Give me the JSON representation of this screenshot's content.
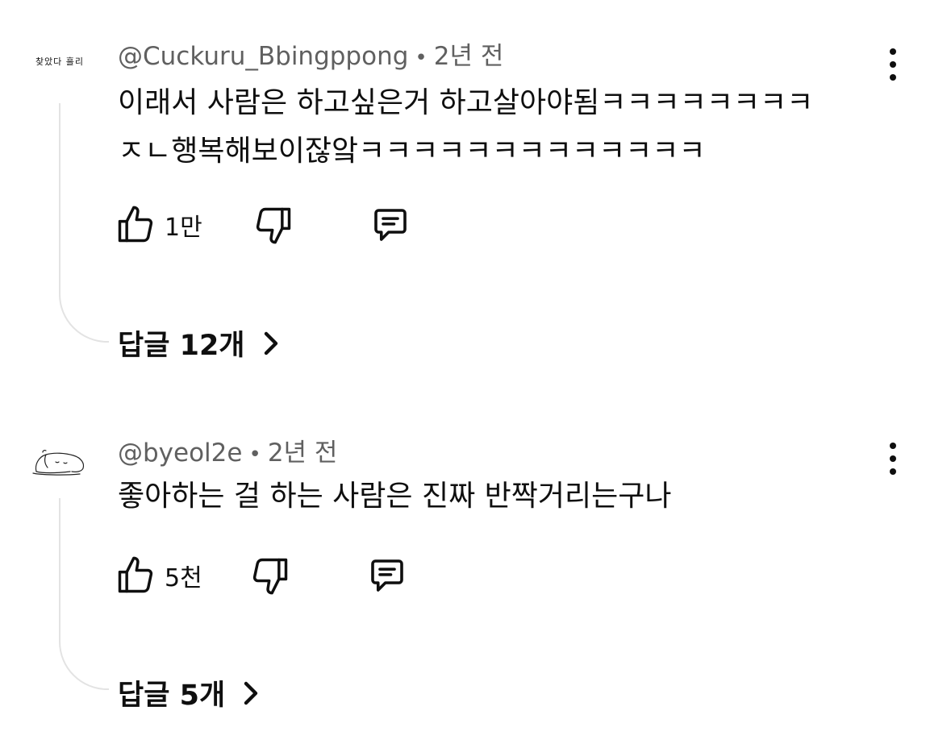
{
  "comments": [
    {
      "avatar_text": "찾았다 흘리",
      "username": "@Cuckuru_Bbingppong",
      "separator": "•",
      "time": "2년 전",
      "text_line1": "이래서 사람은 하고싶은거 하고살아야됨ㅋㅋㅋㅋㅋㅋㅋㅋ",
      "text_line2": "ㅈㄴ행복해보이잖앜ㅋㅋㅋㅋㅋㅋㅋㅋㅋㅋㅋㅋㅋ",
      "like_count": "1만",
      "replies_label": "답글 12개",
      "icons": [
        "thumbs-up-icon",
        "thumbs-down-icon",
        "reply-comment-icon",
        "more-vert-icon",
        "chevron-right-icon"
      ]
    },
    {
      "avatar_icon": "sleeping-character-avatar",
      "username": "@byeol2e",
      "separator": "•",
      "time": "2년 전",
      "text_line1": "좋아하는 걸 하는 사람은 진짜 반짝거리는구나",
      "like_count": "5천",
      "replies_label": "답글 5개",
      "icons": [
        "thumbs-up-icon",
        "thumbs-down-icon",
        "reply-comment-icon",
        "more-vert-icon",
        "chevron-right-icon"
      ]
    }
  ]
}
